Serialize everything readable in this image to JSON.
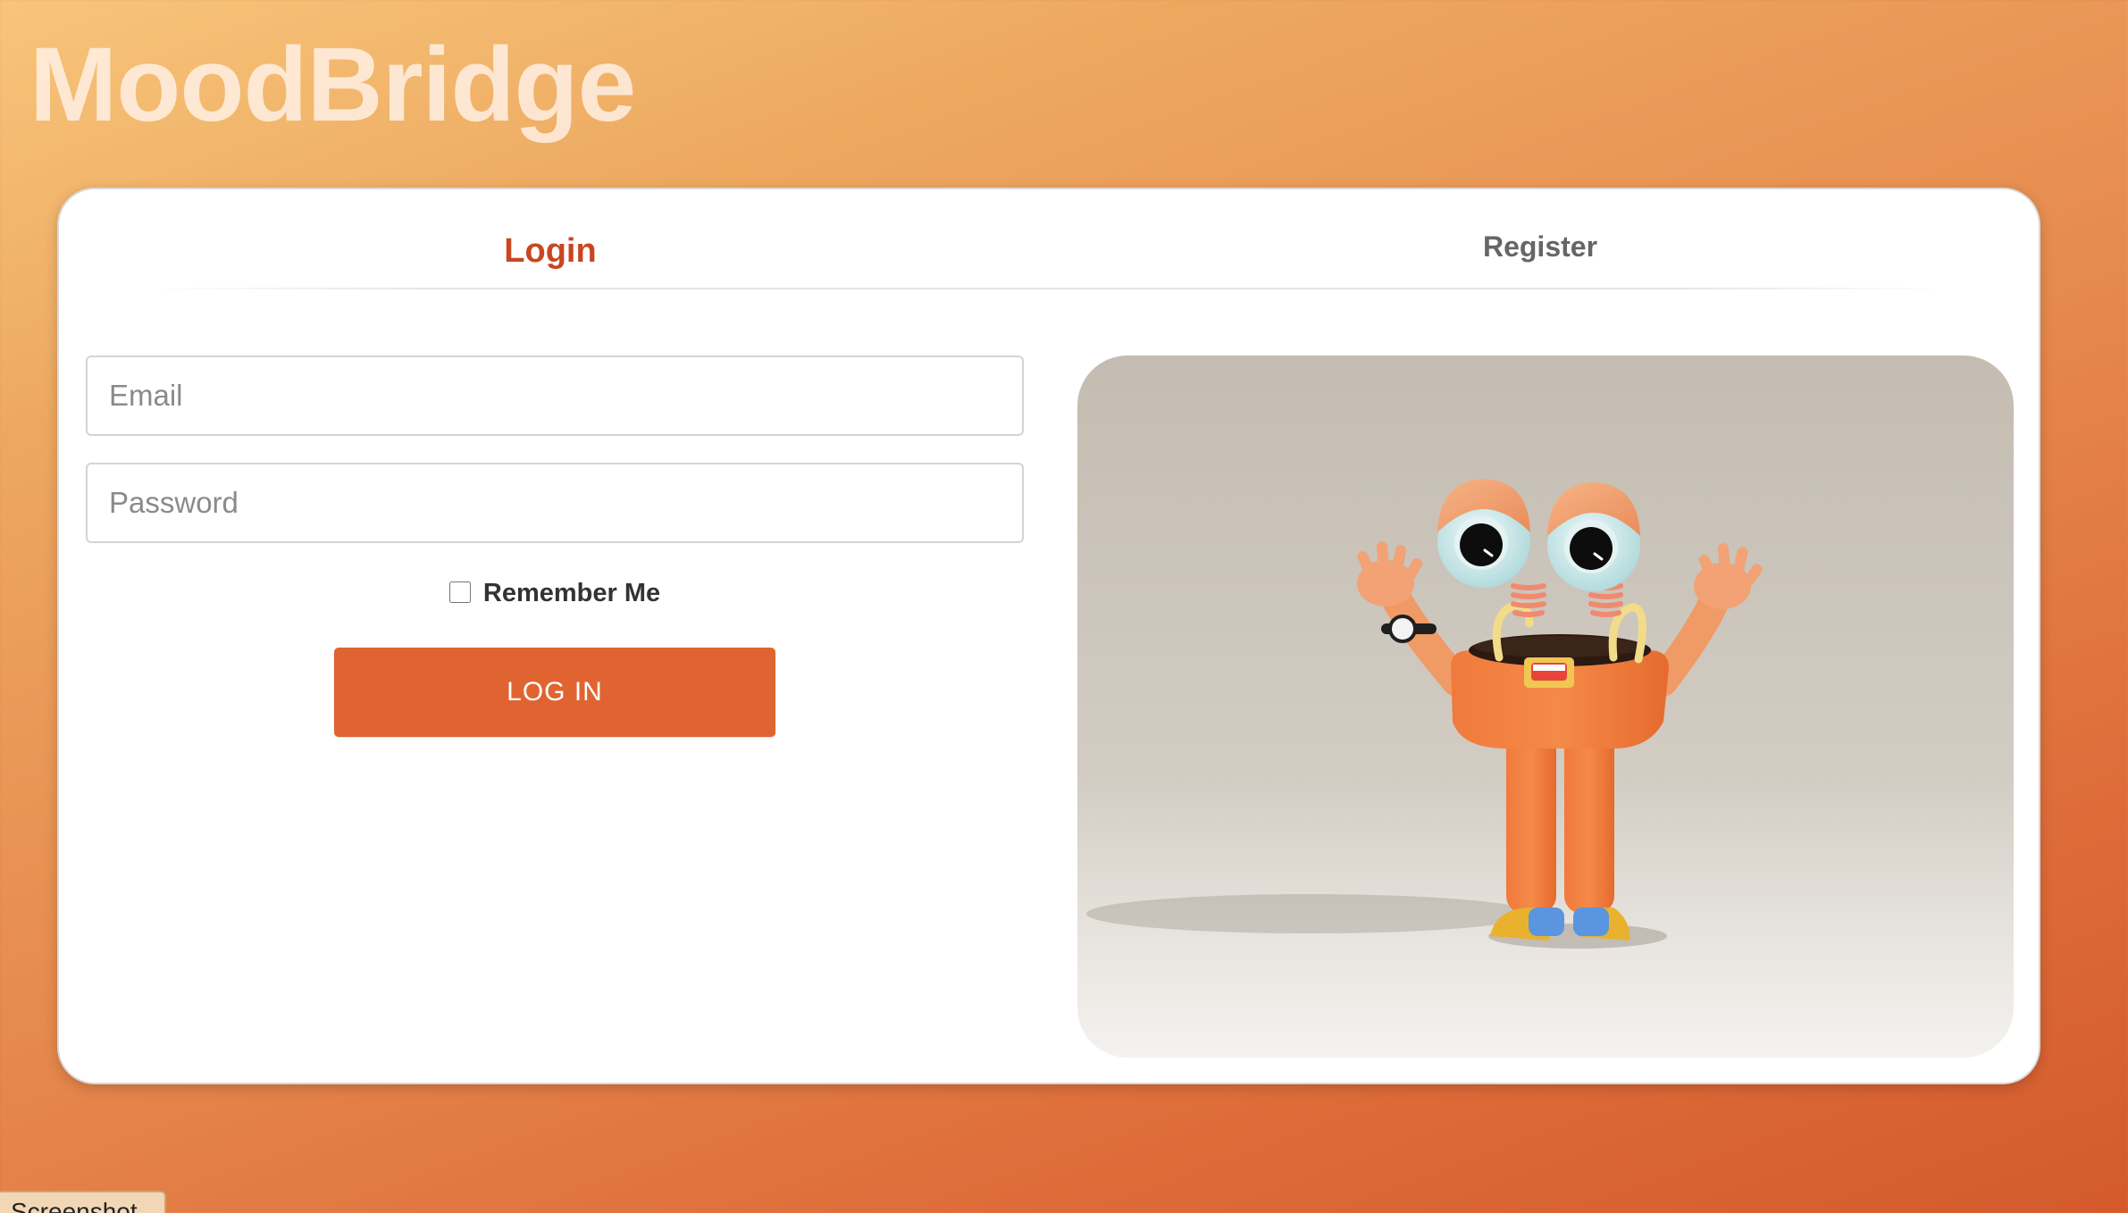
{
  "app": {
    "title": "MoodBridge"
  },
  "tabs": {
    "login_label": "Login",
    "register_label": "Register"
  },
  "form": {
    "email_placeholder": "Email",
    "email_value": "",
    "password_placeholder": "Password",
    "password_value": "",
    "remember_label": "Remember Me",
    "remember_checked": false,
    "submit_label": "LOG IN"
  },
  "footer": {
    "screenshot_label": "Screenshot"
  },
  "colors": {
    "accent": "#e06431",
    "active_tab": "#c84620",
    "inactive_tab": "#666666",
    "background_start": "#f7c57a",
    "background_end": "#d45a2c"
  },
  "illustration": {
    "icon": "cartoon-character-waving-icon"
  }
}
